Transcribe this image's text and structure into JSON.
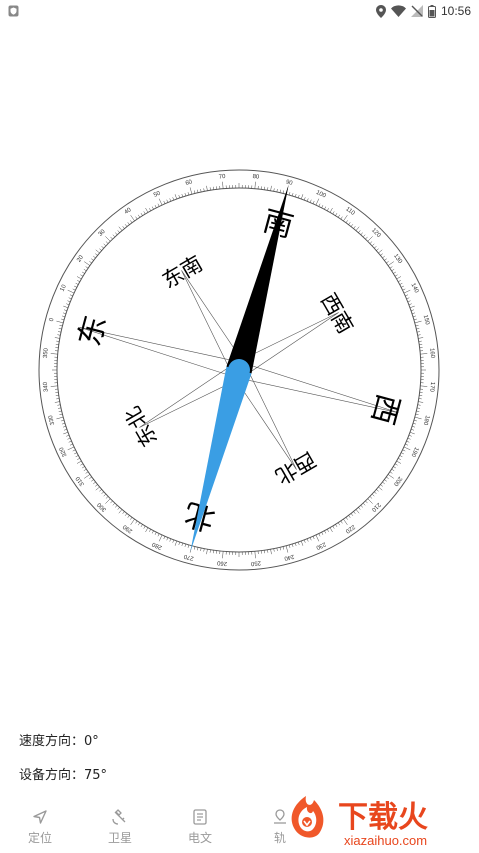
{
  "status_bar": {
    "time": "10:56",
    "icons": [
      "shield-icon",
      "location-icon",
      "wifi-icon",
      "signal-off-icon",
      "battery-icon"
    ]
  },
  "compass": {
    "directions": [
      {
        "label": "东"
      },
      {
        "label": "东北"
      },
      {
        "label": "北"
      },
      {
        "label": "西北"
      },
      {
        "label": "西"
      },
      {
        "label": "西南"
      },
      {
        "label": "南"
      },
      {
        "label": "东南"
      }
    ],
    "device_heading_deg": 75
  },
  "info": {
    "speed_direction": "速度方向：0°",
    "device_direction": "设备方向：75°"
  },
  "nav": {
    "items": [
      {
        "label": "定位",
        "icon": "navigation-arrow-icon"
      },
      {
        "label": "卫星",
        "icon": "satellite-icon"
      },
      {
        "label": "电文",
        "icon": "document-icon"
      },
      {
        "label": "轨",
        "icon": "track-icon"
      }
    ]
  },
  "watermark": {
    "brand_cn": "下载火",
    "brand_en": "xiazaihuo.com"
  },
  "colors": {
    "needle_blue": "#3a9ee4",
    "needle_black": "#000000",
    "watermark": "#e8461d",
    "nav_gray": "#9a9a9a"
  }
}
